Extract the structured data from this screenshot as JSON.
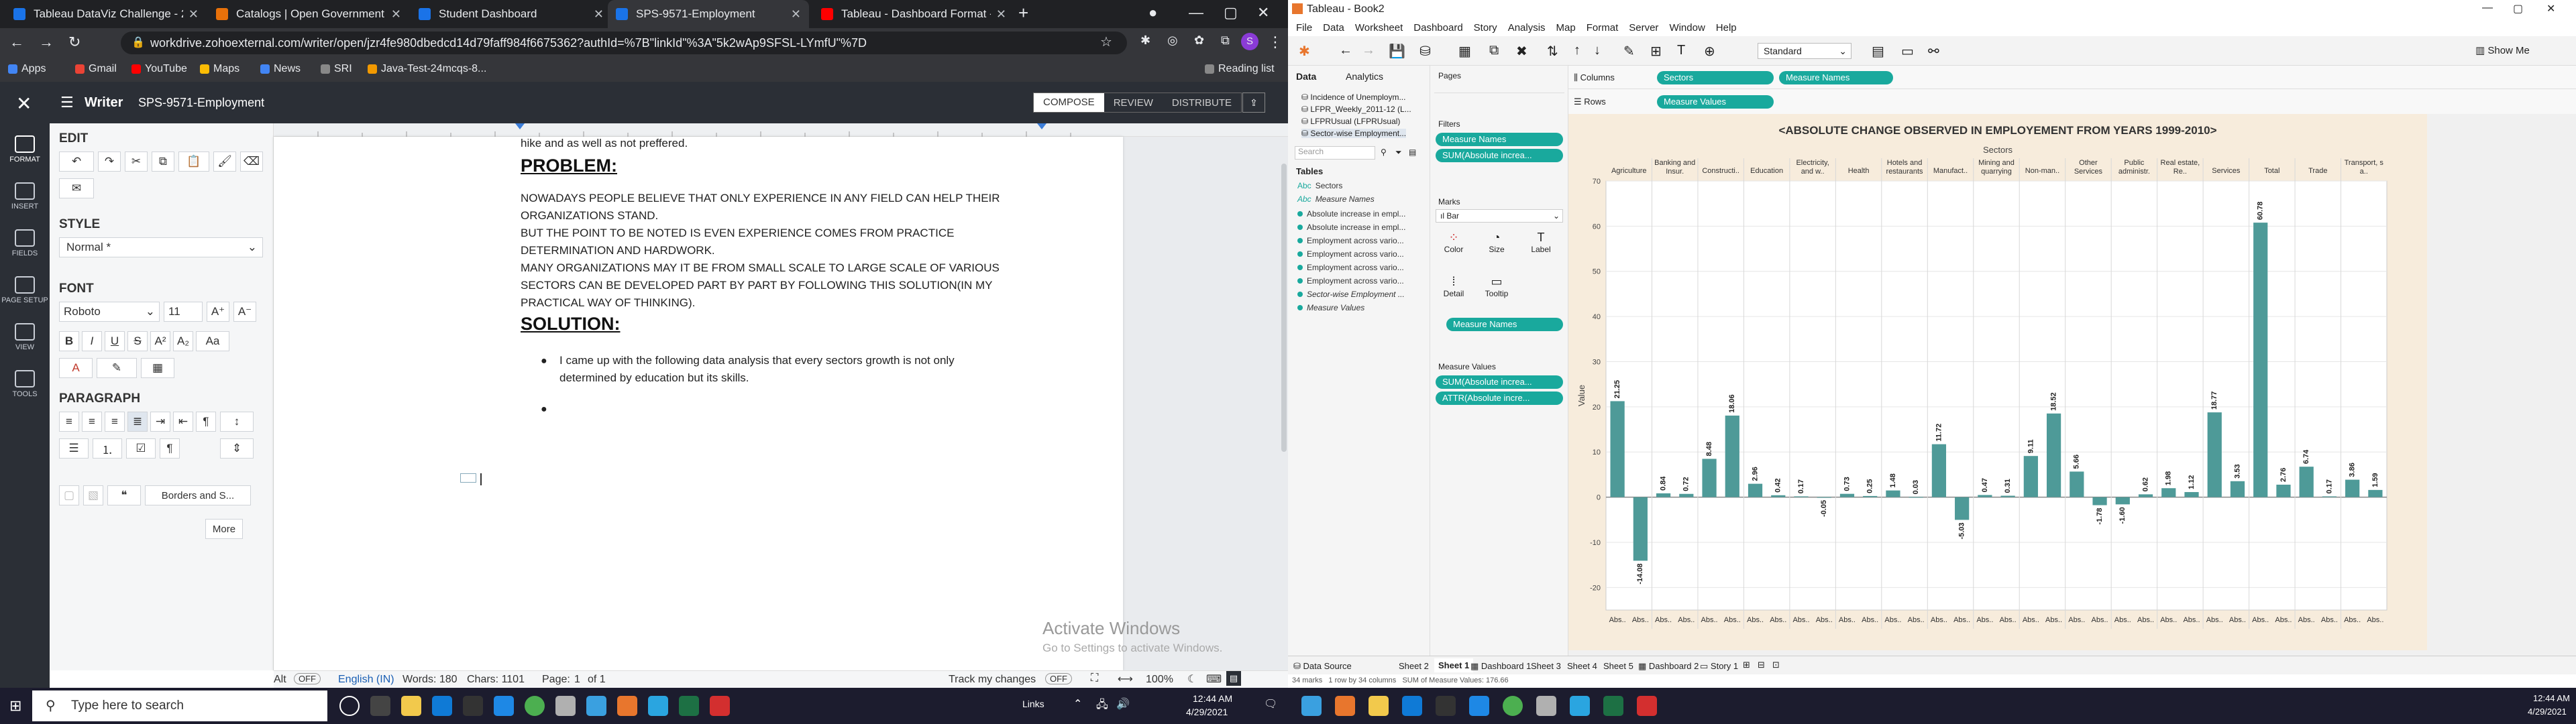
{
  "browser": {
    "tabs": [
      {
        "title": "Tableau DataViz Challenge - 202",
        "color": "#1a73e8"
      },
      {
        "title": "Catalogs | Open Government Da",
        "color": "#e8710a"
      },
      {
        "title": "Student Dashboard",
        "color": "#1a73e8"
      },
      {
        "title": "SPS-9571-Employment",
        "color": "#1a73e8"
      },
      {
        "title": "Tableau - Dashboard Format - Yo",
        "color": "#ff0000"
      }
    ],
    "url": "workdrive.zohoexternal.com/writer/open/jzr4fe980dbedcd14d79faff984f6675362?authId=%7B\"linkId\"%3A\"5k2wAp9SFSL-LYmfU\"%7D",
    "bookmarks": [
      "Apps",
      "Gmail",
      "YouTube",
      "Maps",
      "News",
      "SRI",
      "Java-Test-24mcqs-8..."
    ],
    "reading_list": "Reading list"
  },
  "writer": {
    "app_name": "Writer",
    "doc_title": "SPS-9571-Employment",
    "modes": [
      "COMPOSE",
      "REVIEW",
      "DISTRIBUTE"
    ],
    "side_nav": [
      "FORMAT",
      "INSERT",
      "FIELDS",
      "PAGE SETUP",
      "VIEW",
      "TOOLS"
    ],
    "sections": {
      "edit": "EDIT",
      "style": "STYLE",
      "style_value": "Normal *",
      "font": "FONT",
      "font_name": "Roboto",
      "font_size": "11",
      "paragraph": "PARAGRAPH",
      "borders": "Borders and S...",
      "more": "More"
    },
    "doc": {
      "line0": "hike and as well as not preffered.",
      "problem_heading": "PROBLEM:",
      "problem_lines": [
        "NOWADAYS PEOPLE BELIEVE THAT ONLY EXPERIENCE IN ANY FIELD CAN HELP THEIR",
        "ORGANIZATIONS STAND.",
        "BUT THE POINT TO BE NOTED IS EVEN EXPERIENCE COMES FROM PRACTICE",
        "DETERMINATION AND HARDWORK.",
        "MANY ORGANIZATIONS MAY IT BE FROM SMALL SCALE TO LARGE SCALE OF VARIOUS",
        "SECTORS CAN BE DEVELOPED PART BY PART BY FOLLOWING THIS SOLUTION(IN MY",
        "PRACTICAL WAY OF THINKING)."
      ],
      "solution_heading": "SOLUTION:",
      "bullet1_l1": "I came up with the following data analysis that every sectors growth is not only",
      "bullet1_l2": "determined by education but its skills."
    },
    "status": {
      "alt_label": "Alt",
      "alt_state": "OFF",
      "language": "English (IN)",
      "words": "Words: 180",
      "chars": "Chars: 1101",
      "page_label": "Page:",
      "page_num": "1",
      "page_of": "of 1",
      "track_changes": "Track my changes",
      "track_state": "OFF",
      "zoom": "100%"
    },
    "watermark": {
      "line1": "Activate Windows",
      "line2": "Go to Settings to activate Windows."
    }
  },
  "tableau": {
    "window_title": "Tableau - Book2",
    "menu": [
      "File",
      "Data",
      "Worksheet",
      "Dashboard",
      "Story",
      "Analysis",
      "Map",
      "Format",
      "Server",
      "Window",
      "Help"
    ],
    "standard": "Standard",
    "show_me": "Show Me",
    "data_tab": "Data",
    "analytics_tab": "Analytics",
    "sources": [
      "Incidence of Unemploym...",
      "LFPR_Weekly_2011-12 (L...",
      "LFPRUsual (LFPRUsual)",
      "Sector-wise Employment..."
    ],
    "search_placeholder": "Search",
    "tables_label": "Tables",
    "fields": [
      "Sectors",
      "Measure Names",
      "Absolute increase in empl...",
      "Absolute increase in empl...",
      "Employment across vario...",
      "Employment across vario...",
      "Employment across vario...",
      "Employment across vario...",
      "Sector-wise Employment ...",
      "Measure Values"
    ],
    "pages": "Pages",
    "filters": "Filters",
    "filter_pills": [
      "Measure Names",
      "SUM(Absolute increa..."
    ],
    "marks": "Marks",
    "mark_type": "Bar",
    "mark_buttons": [
      "Color",
      "Size",
      "Label",
      "Detail",
      "Tooltip"
    ],
    "marks_pill": "Measure Names",
    "measure_values_label": "Measure Values",
    "mv_pills": [
      "SUM(Absolute increa...",
      "ATTR(Absolute incre..."
    ],
    "columns_label": "Columns",
    "rows_label": "Rows",
    "col_pills": [
      "Sectors",
      "Measure Names"
    ],
    "row_pills": [
      "Measure Values"
    ],
    "sheets": [
      "Data Source",
      "Sheet 2",
      "Sheet 1",
      "Dashboard 1",
      "Sheet 3",
      "Sheet 4",
      "Sheet 5",
      "Dashboard 2",
      "Story 1"
    ],
    "status_text": "34 marks   1 row by 34 columns   SUM of Measure Values: 176.66"
  },
  "chart_data": {
    "type": "bar",
    "title": "<ABSOLUTE CHANGE OBSERVED IN EMPLOYEMENT FROM YEARS 1999-2010>",
    "xlabel": "Sectors",
    "ylabel": "Value",
    "ylim": [
      -25,
      70
    ],
    "yticks": [
      -20,
      -10,
      0,
      10,
      20,
      30,
      40,
      50,
      60,
      70
    ],
    "bar_color": "#4e9a98",
    "categories": [
      "Agriculture",
      "Banking and Insur.",
      "Constructi..",
      "Education",
      "Electricity, gas and w..",
      "Health",
      "Hotels and restaurants",
      "Manufact..",
      "Mining and quarrying",
      "Non-man..",
      "Other Services",
      "Public administr.",
      "Real estate, Re..",
      "Services",
      "Total",
      "Trade",
      "Transport, storage a.."
    ],
    "sub_label": "Abs..",
    "values": [
      [
        21.25,
        -14.08
      ],
      [
        0.84,
        0.72
      ],
      [
        8.48,
        18.06
      ],
      [
        2.96,
        0.42
      ],
      [
        0.17,
        -0.05
      ],
      [
        0.73,
        0.25
      ],
      [
        1.48,
        0.03
      ],
      [
        11.72,
        -5.03
      ],
      [
        0.47,
        0.31
      ],
      [
        9.11,
        18.52
      ],
      [
        5.66,
        -1.78
      ],
      [
        -1.6,
        0.62
      ],
      [
        1.98,
        1.12
      ],
      [
        18.77,
        3.53
      ],
      [
        60.78,
        2.76
      ],
      [
        6.74,
        0.17
      ],
      [
        3.86,
        1.59
      ]
    ],
    "labels": [
      [
        "21.25",
        "-14.08"
      ],
      [
        "0.84",
        "0.72"
      ],
      [
        "8.48",
        "18.06"
      ],
      [
        "2.96",
        "0.42"
      ],
      [
        "0.17",
        "-0.05"
      ],
      [
        "0.73",
        "0.25"
      ],
      [
        "1.48",
        "0.03"
      ],
      [
        "11.72",
        "-5.03"
      ],
      [
        "0.47",
        "0.31"
      ],
      [
        "9.11",
        "18.52"
      ],
      [
        "5.66",
        "-1.78"
      ],
      [
        "-1.60",
        "0.62"
      ],
      [
        "1.98",
        "1.12"
      ],
      [
        "18.77",
        "3.53"
      ],
      [
        "60.78",
        "2.76"
      ],
      [
        "6.74",
        "0.17"
      ],
      [
        "3.86",
        "1.59"
      ]
    ]
  },
  "taskbar": {
    "search_placeholder": "Type here to search",
    "links": "Links",
    "time": "12:44 AM",
    "date": "4/29/2021",
    "time2": "12:44 AM",
    "date2": "4/29/2021"
  }
}
